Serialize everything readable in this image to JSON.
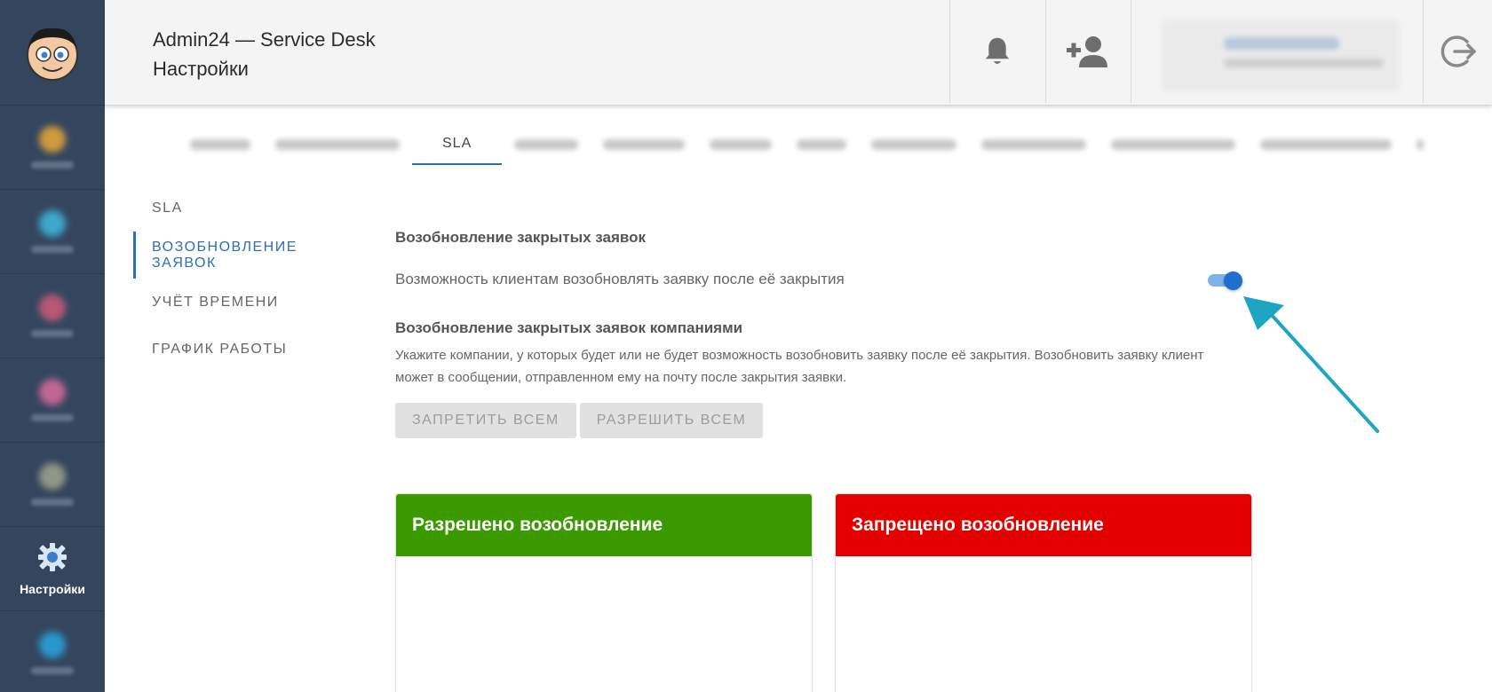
{
  "header": {
    "app_title": "Admin24 — Service Desk",
    "page_title": "Настройки"
  },
  "sidebar": {
    "active_label": "Настройки"
  },
  "tabs": {
    "active_label": "SLA"
  },
  "submenu": {
    "items": [
      "SLA",
      "ВОЗОБНОВЛЕНИЕ ЗАЯВОК",
      "УЧЁТ ВРЕМЕНИ",
      "ГРАФИК РАБОТЫ"
    ]
  },
  "content": {
    "section1_title": "Возобновление закрытых заявок",
    "toggle_label": "Возможность клиентам возобновлять заявку после её закрытия",
    "toggle_on": true,
    "section2_title": "Возобновление закрытых заявок компаниями",
    "section2_desc": "Укажите компании, у которых будет или не будет возможность возобновить заявку после её закрытия. Возобновить заявку клиент может в сообщении, отправленном ему на почту после закрытия заявки.",
    "deny_all_label": "ЗАПРЕТИТЬ ВСЕМ",
    "allow_all_label": "РАЗРЕШИТЬ ВСЕМ"
  },
  "panels": {
    "allowed_title": "Разрешено возобновление",
    "denied_title": "Запрещено возобновление"
  },
  "colors": {
    "allowed_header": "#3b9a00",
    "denied_header": "#e50000",
    "accent": "#2e6fb0",
    "toggle": "#1f6fd0",
    "annotation_arrow": "#1ea5c4"
  }
}
